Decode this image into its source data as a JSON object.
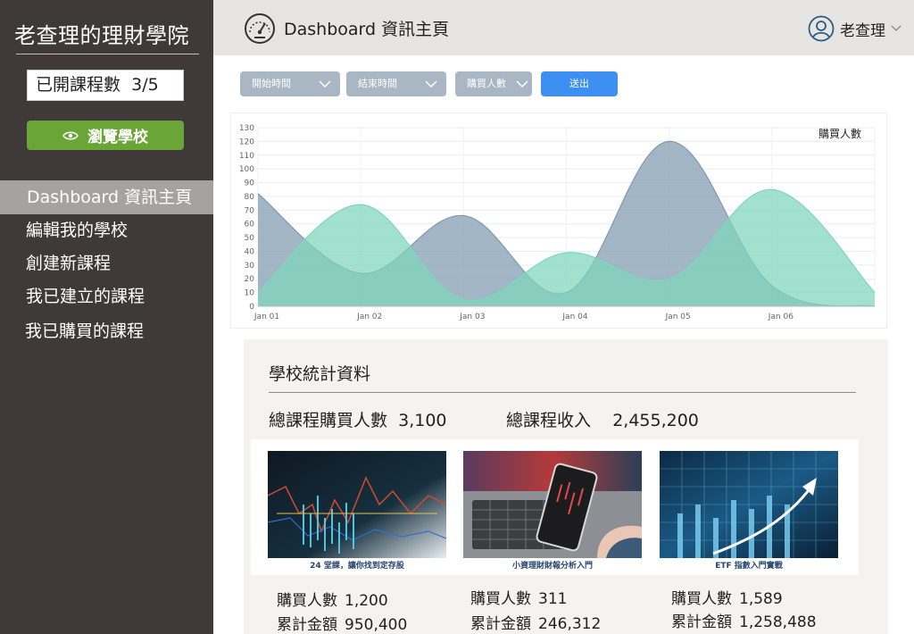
{
  "sidebar": {
    "brand": "老查理的理財學院",
    "course_count_label": "已開課程數",
    "course_count_value": "3/5",
    "browse_button": "瀏覽學校",
    "nav": [
      {
        "label": "Dashboard 資訊主頁",
        "active": true
      },
      {
        "label": "編輯我的學校"
      },
      {
        "label": "創建新課程"
      },
      {
        "label": "我已建立的課程"
      },
      {
        "label": "我已購買的課程"
      }
    ]
  },
  "header": {
    "icon": "speedometer-icon",
    "title": "Dashboard 資訊主頁",
    "user_name": "老查理",
    "user_icon": "user-circle-icon"
  },
  "filters": {
    "start_time": "開始時間",
    "end_time": "結束時間",
    "buyers": "購買人數",
    "submit": "送出"
  },
  "chart_data": {
    "type": "area",
    "legend": "購買人數",
    "legend_position": "top-right",
    "categories": [
      "Jan 01",
      "Jan 02",
      "Jan 03",
      "Jan 04",
      "Jan 05",
      "Jan 06"
    ],
    "ylim": [
      0,
      130
    ],
    "yticks": [
      0,
      10,
      20,
      30,
      40,
      50,
      60,
      70,
      80,
      90,
      100,
      110,
      120,
      130
    ],
    "grid": true,
    "series": [
      {
        "color": "#7e9aae",
        "points": [
          [
            0,
            82
          ],
          [
            1,
            24
          ],
          [
            2,
            66
          ],
          [
            3,
            10
          ],
          [
            4,
            120
          ],
          [
            5,
            15
          ],
          [
            6,
            0
          ]
        ]
      },
      {
        "color": "#7ed6bb",
        "points": [
          [
            0,
            10
          ],
          [
            1,
            74
          ],
          [
            2,
            5
          ],
          [
            3,
            39
          ],
          [
            4,
            20
          ],
          [
            5,
            85
          ],
          [
            6,
            10
          ]
        ]
      }
    ]
  },
  "stats": {
    "title": "學校統計資料",
    "total_buyers_label": "總課程購買人數",
    "total_buyers_value": "3,100",
    "total_income_label": "總課程收入",
    "total_income_value": "2,455,200",
    "buyers_label": "購買人數",
    "amount_label": "累計金額",
    "courses": [
      {
        "caption": "24 堂課，讓你找到定存股",
        "buyers": "1,200",
        "amount": "950,400"
      },
      {
        "caption": "小資理財財報分析入門",
        "buyers": "311",
        "amount": "246,312"
      },
      {
        "caption": "ETF 指數入門實戰",
        "buyers": "1,589",
        "amount": "1,258,488"
      }
    ]
  }
}
